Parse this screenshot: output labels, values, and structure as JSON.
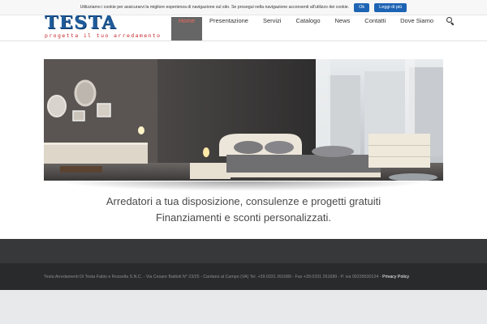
{
  "cookie": {
    "text": "Utilizziamo i cookie per assicurarvi la migliore esperienza di navigazione sul sito. Se prosegui nella navigazione acconsenti all'utilizzo dei cookie.",
    "ok_label": "Ok",
    "more_label": "Leggi di più"
  },
  "logo": {
    "name": "TESTA",
    "tagline": "progetta il tuo arredamento"
  },
  "nav": {
    "items": [
      {
        "label": "Home",
        "active": true
      },
      {
        "label": "Presentazione"
      },
      {
        "label": "Servizi"
      },
      {
        "label": "Catalogo"
      },
      {
        "label": "News"
      },
      {
        "label": "Contatti"
      },
      {
        "label": "Dove Siamo"
      }
    ],
    "search_icon": "search-icon"
  },
  "hero": {
    "description": "bedroom-interior-photo"
  },
  "main": {
    "line1": "Arredatori a tua disposizione, consulenze e progetti gratuiti",
    "line2": "Finanziamenti e sconti personalizzati."
  },
  "footer": {
    "copyright": "Testa Arredamenti Di Testa Fabio e Rossella S.N.C. - Via Cesare Battisti N° 23/25 - Cardano al Campo (VA) Tel. +39.0331 261689 - Fax +39.0331 261689 - P. iva 00239530124 - ",
    "privacy_label": "Privacy Policy"
  },
  "colors": {
    "brand_blue": "#1f5c9c",
    "brand_red": "#c4242a",
    "active_nav": "#666666",
    "footer": "#363839"
  }
}
